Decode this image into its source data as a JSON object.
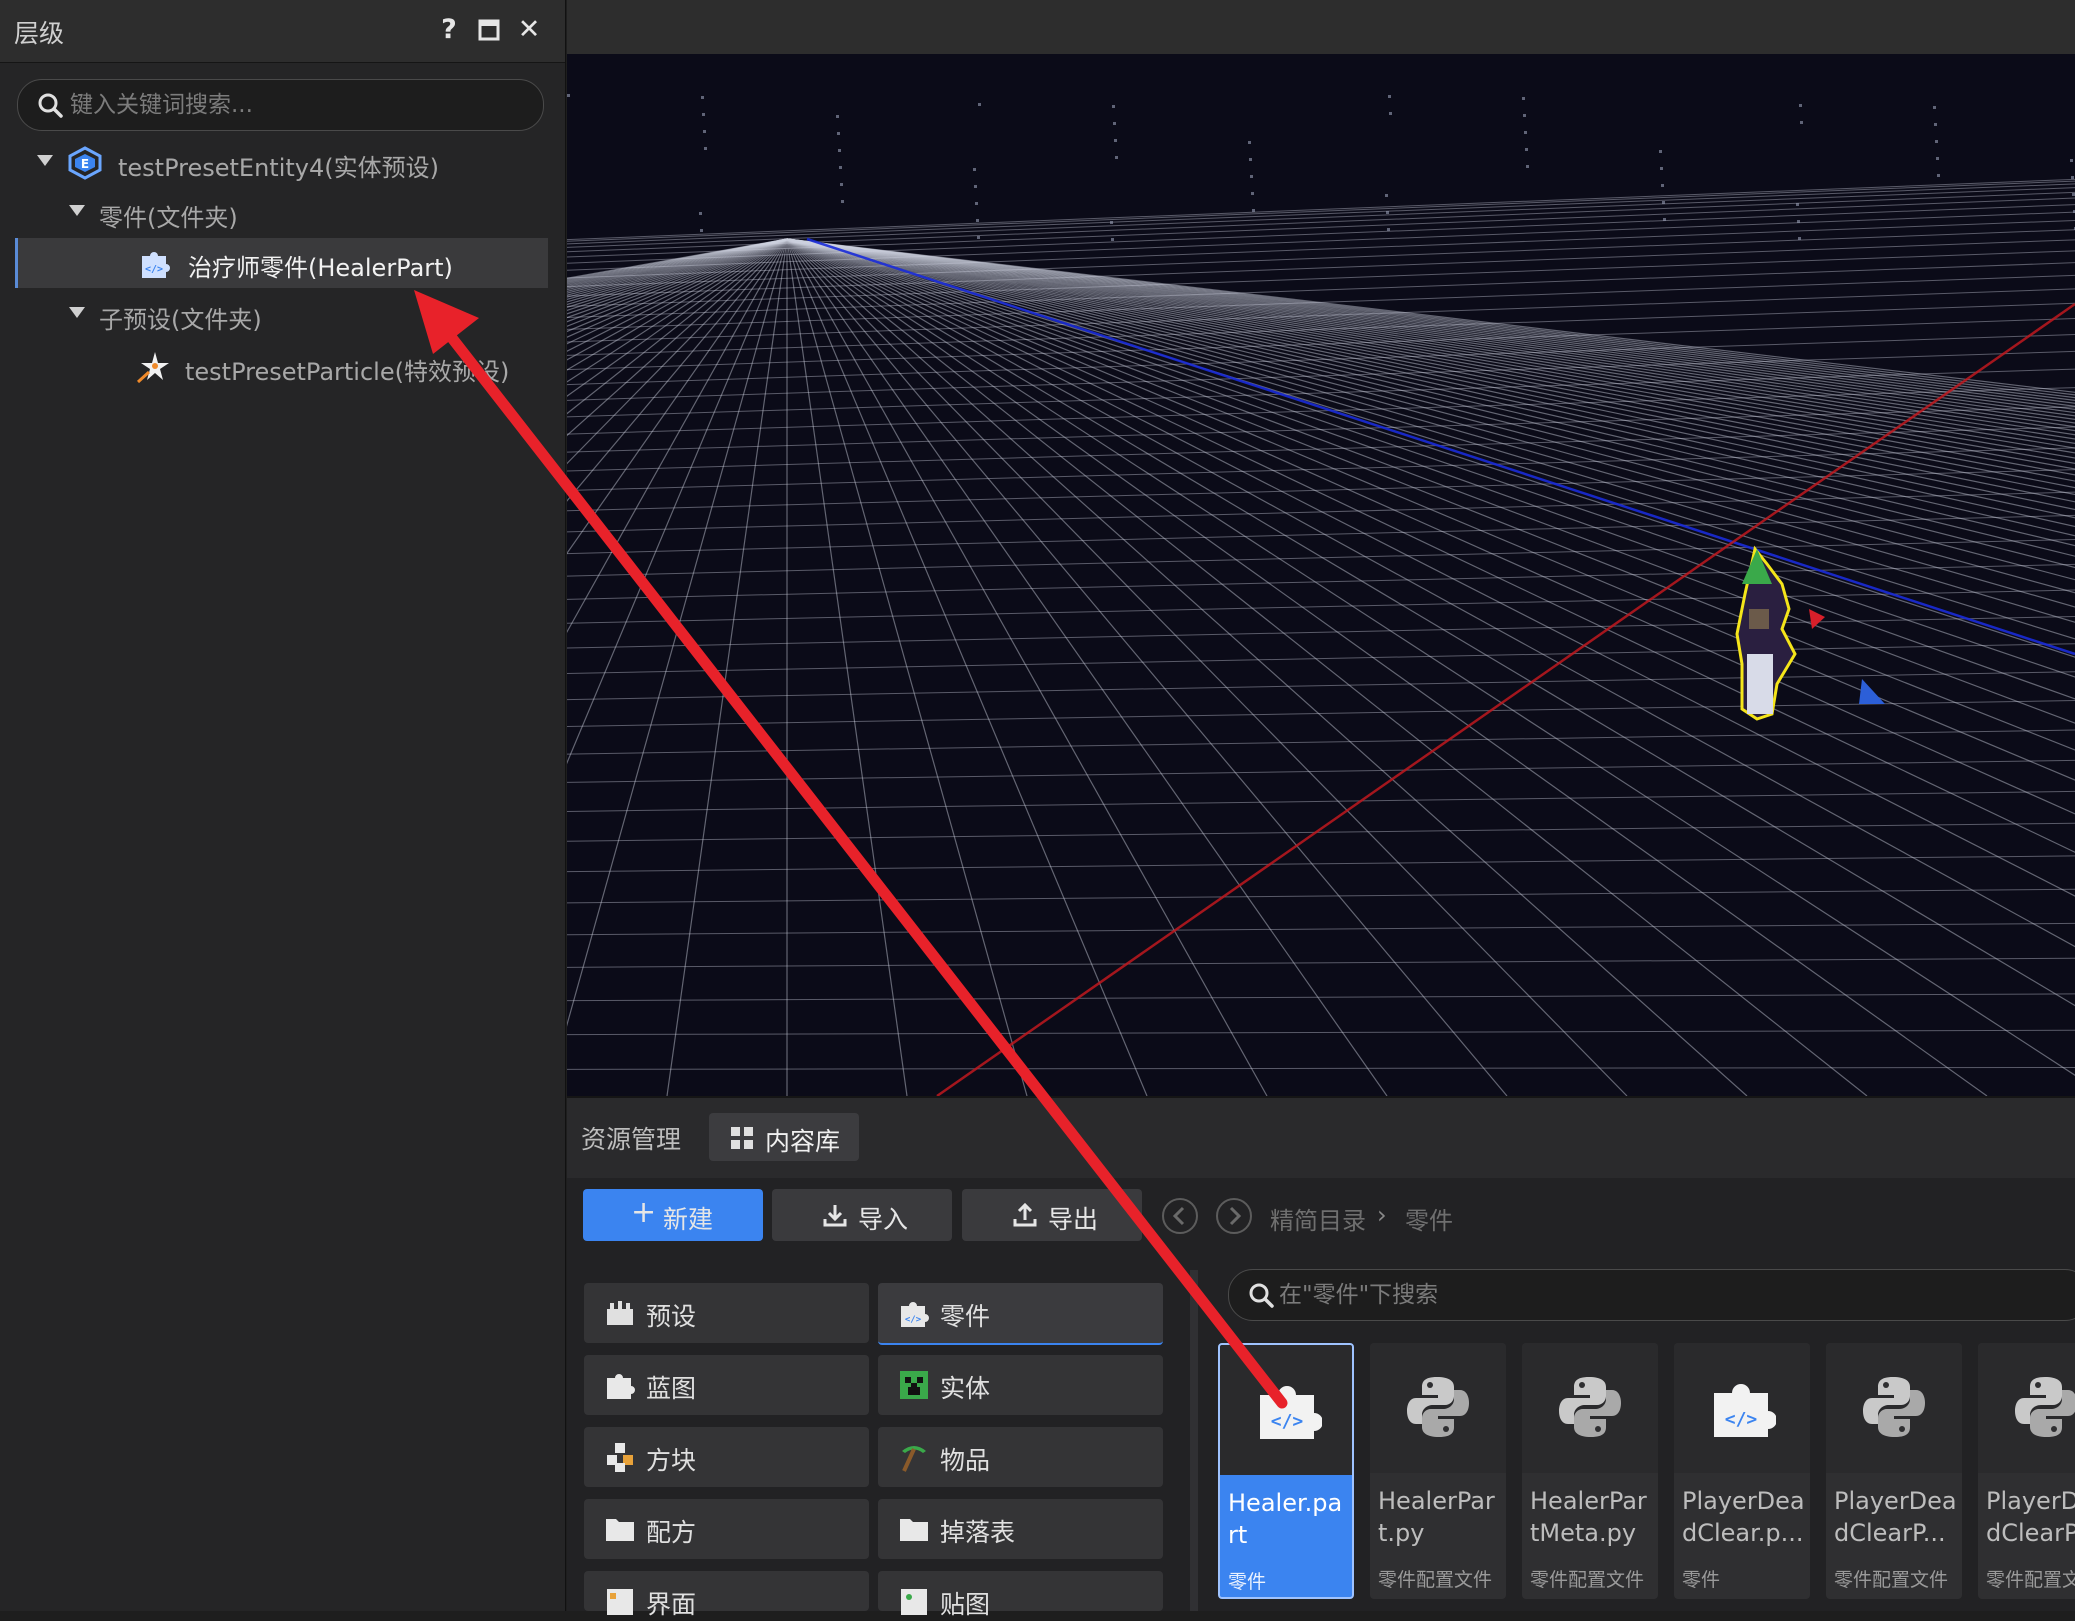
{
  "hierarchy": {
    "title": "层级",
    "help_label": "?",
    "close_label": "✕",
    "search_placeholder": "键入关键词搜索...",
    "tree": [
      {
        "label": "testPresetEntity4(实体预设)",
        "icon": "entity-preset-icon"
      },
      {
        "label": "零件(文件夹)",
        "icon": "none"
      },
      {
        "label": "治疗师零件(HealerPart)",
        "icon": "part-puzzle-icon",
        "selected": true
      },
      {
        "label": "子预设(文件夹)",
        "icon": "none"
      },
      {
        "label": "testPresetParticle(特效预设)",
        "icon": "particle-star-icon"
      }
    ]
  },
  "assets": {
    "tab_assets": "资源管理",
    "tab_library": "内容库",
    "btn_new": "新建",
    "btn_import": "导入",
    "btn_export": "导出",
    "btn_new_plus": "+",
    "breadcrumb_root": "精简目录",
    "breadcrumb_sep": "›",
    "breadcrumb_leaf": "零件",
    "file_search_placeholder": "在\"零件\"下搜索",
    "categories": [
      {
        "label": "预设"
      },
      {
        "label": "零件"
      },
      {
        "label": "蓝图"
      },
      {
        "label": "实体"
      },
      {
        "label": "方块"
      },
      {
        "label": "物品"
      },
      {
        "label": "配方"
      },
      {
        "label": "掉落表"
      },
      {
        "label": "界面"
      },
      {
        "label": "贴图"
      }
    ],
    "files": [
      {
        "name": "Healer.part",
        "type": "零件",
        "icon": "part-puzzle-icon"
      },
      {
        "name": "HealerPart.py",
        "type": "零件配置文件",
        "icon": "python-icon"
      },
      {
        "name": "HealerPartMeta.py",
        "type": "零件配置文件",
        "icon": "python-icon"
      },
      {
        "name": "PlayerDeadClear.p...",
        "type": "零件",
        "icon": "part-puzzle-icon"
      },
      {
        "name": "PlayerDeadClearP...",
        "type": "零件配置文件",
        "icon": "python-icon"
      },
      {
        "name": "PlayerDeadClearP",
        "type": "零件配置文",
        "icon": "python-icon"
      }
    ]
  },
  "colors": {
    "accent": "#3b84f0",
    "arrow": "#e8222a",
    "axis_red": "#c0191e",
    "axis_blue": "#1a2bd8"
  }
}
